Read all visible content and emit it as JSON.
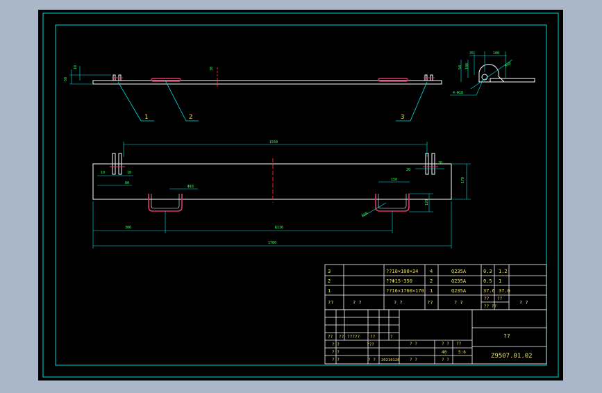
{
  "colors": {
    "app_bg": "#a9b7c8",
    "canvas_bg": "#000000",
    "frame": "#00d8d8",
    "outline": "#ffffff",
    "part_red": "#e0366a",
    "dim_cyan": "#00e6e6",
    "dim_green": "#39ff5a",
    "text_yellow": "#e8e06a",
    "center_red": "#ff2020"
  },
  "balloons": [
    "1",
    "2",
    "3"
  ],
  "dimensions": {
    "top_left_height": "50",
    "top_small_left": "10",
    "top_mid": "30",
    "side_top_a": "35",
    "side_top_b": "100",
    "side_left_a": "50",
    "side_left_b": "100",
    "side_diag": "R50",
    "side_hole": "4-Φ18",
    "plan_top": "1550",
    "plan_left_a": "10",
    "plan_left_b": "10",
    "plan_left_c": "80",
    "plan_right_a": "10",
    "plan_right_b": "20",
    "plan_bar": "Φ16",
    "plan_handle_w": "150",
    "plan_handle_h": "120",
    "plan_handle_r": "R50",
    "plan_height": "170",
    "plan_bottom_left": "306",
    "plan_bottom_mid": "R116",
    "plan_overall": "1700"
  },
  "bom_rows": [
    {
      "no": "3",
      "name": "??10×100×34",
      "qty": "4",
      "mat": "Q235A",
      "w1": "0.3",
      "w2": "1.2",
      "note": ""
    },
    {
      "no": "2",
      "name": "??Φ15-350",
      "qty": "2",
      "mat": "Q235A",
      "w1": "0.5",
      "w2": "1",
      "note": ""
    },
    {
      "no": "1",
      "name": "??16×1760×170",
      "qty": "1",
      "mat": "Q235A",
      "w1": "37.6",
      "w2": "37.6",
      "note": ""
    }
  ],
  "bom_header": {
    "no": "??",
    "name": "?  ?",
    "qty": "?  ?",
    "qty2": "??",
    "mat": "?  ?",
    "w": "??  ??",
    "w_sub1": "??",
    "w_sub2": "??",
    "note": "?  ?"
  },
  "title_block": {
    "drawing_name": "??",
    "drawing_no": "Z9507.01.02",
    "weight": "40",
    "scale": "5:6",
    "stage": "? ?",
    "date": "20210128",
    "row_labels": {
      "a": "??",
      "b": "??",
      "c": "?????",
      "d": "??",
      "e": "?",
      "f": "???",
      "g": "? ?",
      "h": "? ?",
      "i": "? ?",
      "j": "? ?",
      "k": "? ?",
      "l": "? ?",
      "m": "??",
      "n": "? ?",
      "o": "? ?",
      "p": "? ?",
      "q": "? ?",
      "r": "? ?"
    }
  }
}
